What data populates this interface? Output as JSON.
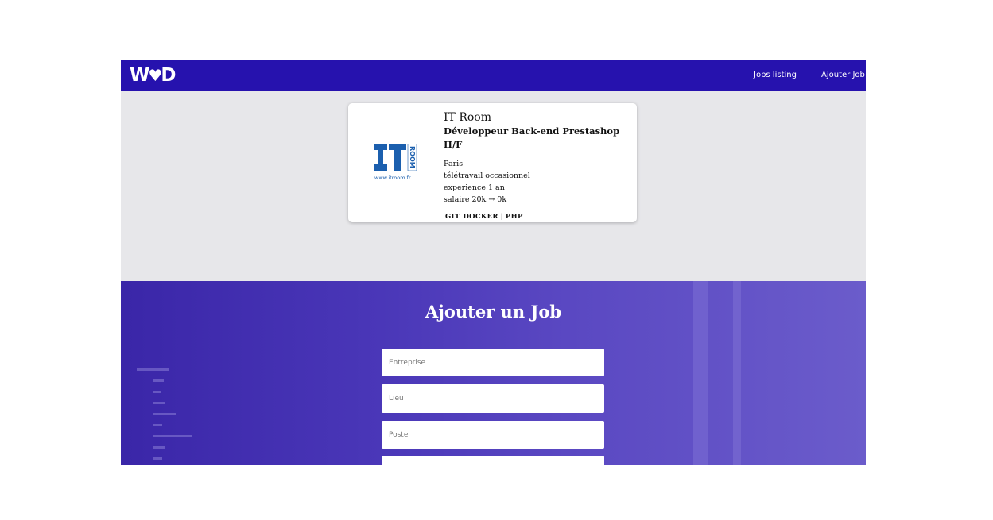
{
  "nav": {
    "logo_text": "W",
    "logo_end": "D",
    "links": [
      {
        "label": "Jobs listing"
      },
      {
        "label": "Ajouter Job"
      }
    ]
  },
  "job_card": {
    "logo_caption": "www.itroom.fr",
    "logo_side_text": "ROOM",
    "company": "IT Room",
    "title": "Développeur Back-end Prestashop H/F",
    "location": "Paris",
    "remote": "télétravail occasionnel",
    "experience": "experience 1 an",
    "salary": "salaire 20k → 0k",
    "tags": [
      "GIT",
      "DOCKER",
      "PHP"
    ]
  },
  "form": {
    "title": "Ajouter un Job",
    "fields": [
      {
        "placeholder": "Entreprise"
      },
      {
        "placeholder": "Lieu"
      },
      {
        "placeholder": "Poste"
      },
      {
        "placeholder": ""
      }
    ]
  },
  "colors": {
    "nav_bg": "#2612ae",
    "page_bg": "#e7e7ea",
    "form_bg": "#4a37b8",
    "logo_blue": "#1b5fae"
  }
}
